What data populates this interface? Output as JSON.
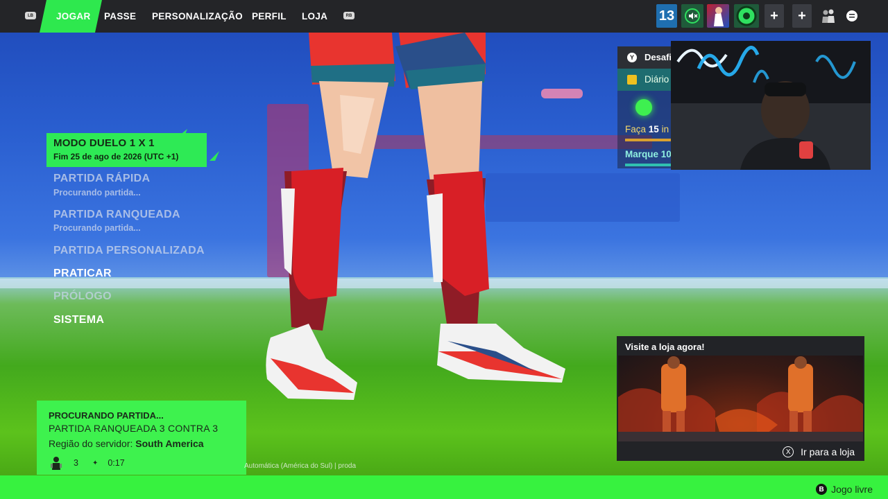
{
  "topbar": {
    "left_bumper": "LB",
    "right_bumper": "RB",
    "tabs": [
      {
        "label": "JOGAR",
        "active": true
      },
      {
        "label": "PASSE"
      },
      {
        "label": "PERSONALIZAÇÃO"
      },
      {
        "label": "PERFIL"
      },
      {
        "label": "LOJA"
      }
    ],
    "level": "13",
    "icons": [
      "level-badge",
      "mute-icon",
      "avatar-icon",
      "ball-icon",
      "plus-icon",
      "plus-icon",
      "party-icon",
      "menu-icon"
    ]
  },
  "menu": {
    "selected": {
      "title": "MODO DUELO 1 X 1",
      "subtitle": "Fim 25 de ago de 2026 (UTC +1)"
    },
    "items": [
      {
        "label": "PARTIDA RÁPIDA",
        "status": "Procurando partida..."
      },
      {
        "label": "PARTIDA RANQUEADA",
        "status": "Procurando partida..."
      },
      {
        "label": "PARTIDA PERSONALIZADA"
      },
      {
        "label": "PRATICAR"
      },
      {
        "label": "PRÓLOGO"
      },
      {
        "label": "SISTEMA"
      }
    ]
  },
  "search": {
    "title": "PROCURANDO PARTIDA...",
    "mode": "PARTIDA RANQUEADA 3 CONTRA 3",
    "region_label": "Região do servidor:",
    "region_value": "South America",
    "players": "3",
    "time": "0:17"
  },
  "version_text": "Automática (América do Sul) | proda",
  "challenges": {
    "button": "Y",
    "title": "Desafi",
    "tab": "Diário",
    "task1_prefix": "Faça",
    "task1_num": "15",
    "task1_suffix": "in",
    "task2": "Marque 10"
  },
  "store": {
    "title": "Visite a loja agora!",
    "button_icon": "X",
    "button_label": "Ir para a loja"
  },
  "bottombar": {
    "button_icon": "B",
    "label": "Jogo livre"
  },
  "colors": {
    "accent": "#2ee84e",
    "topbar": "#242528",
    "bottom": "#37f23f"
  }
}
